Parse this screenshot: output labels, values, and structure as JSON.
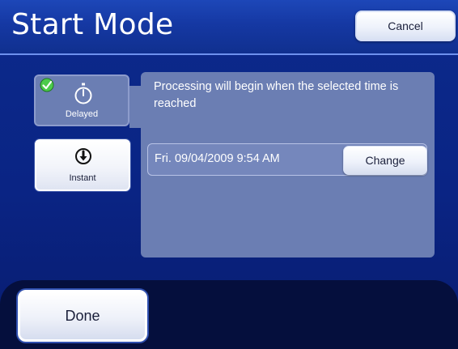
{
  "header": {
    "title": "Start Mode",
    "cancel_label": "Cancel"
  },
  "modes": {
    "delayed": {
      "label": "Delayed",
      "selected": true,
      "icon": "stopwatch-icon"
    },
    "instant": {
      "label": "Instant",
      "selected": false,
      "icon": "arrow-down-circle-icon"
    }
  },
  "panel": {
    "description": "Processing will begin when the selected time is reached",
    "datetime": "Fri. 09/04/2009 9:54 AM",
    "change_label": "Change"
  },
  "footer": {
    "done_label": "Done"
  },
  "colors": {
    "background": "#0c2a8c",
    "panel": "#6b7eb3",
    "footer": "#050f3d",
    "check": "#3ec33e"
  }
}
